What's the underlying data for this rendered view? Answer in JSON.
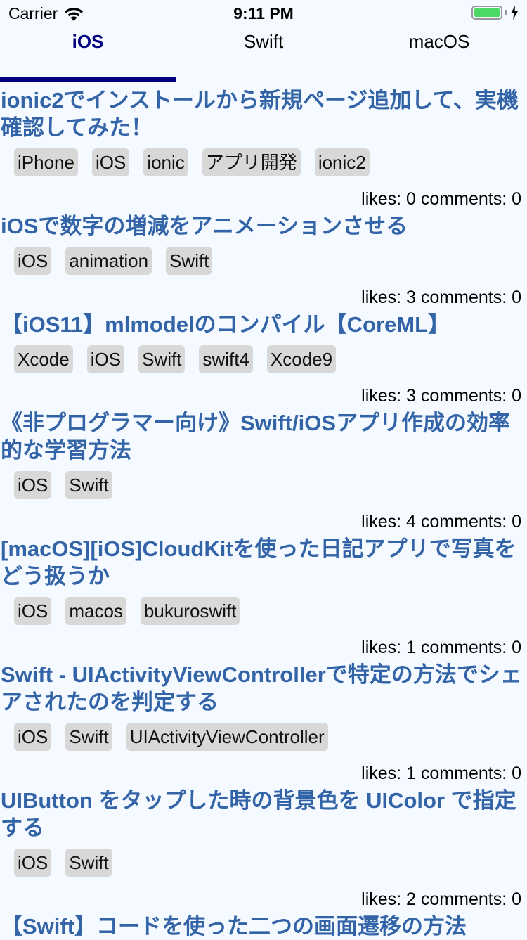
{
  "status_bar": {
    "carrier": "Carrier",
    "time": "9:11 PM",
    "battery_color": "#4cd964"
  },
  "tabs": [
    {
      "label": "iOS",
      "active": true
    },
    {
      "label": "Swift",
      "active": false
    },
    {
      "label": "macOS",
      "active": false
    }
  ],
  "accent_color": "#000080",
  "title_color": "#3464a8",
  "articles": [
    {
      "title": "ionic2でインストールから新規ページ追加して、実機確認してみた！",
      "tags": [
        "iPhone",
        "iOS",
        "ionic",
        "アプリ開発",
        "ionic2"
      ],
      "stats": "likes: 0 comments: 0"
    },
    {
      "title": "iOSで数字の増減をアニメーションさせる",
      "tags": [
        "iOS",
        "animation",
        "Swift"
      ],
      "stats": "likes: 3 comments: 0"
    },
    {
      "title": "【iOS11】mlmodelのコンパイル【CoreML】",
      "tags": [
        "Xcode",
        "iOS",
        "Swift",
        "swift4",
        "Xcode9"
      ],
      "stats": "likes: 3 comments: 0"
    },
    {
      "title": "《非プログラマー向け》Swift/iOSアプリ作成の効率的な学習方法",
      "tags": [
        "iOS",
        "Swift"
      ],
      "stats": "likes: 4 comments: 0"
    },
    {
      "title": "[macOS][iOS]CloudKitを使った日記アプリで写真をどう扱うか",
      "tags": [
        "iOS",
        "macos",
        "bukuroswift"
      ],
      "stats": "likes: 1 comments: 0"
    },
    {
      "title": "Swift - UIActivityViewControllerで特定の方法でシェアされたのを判定する",
      "tags": [
        "iOS",
        "Swift",
        "UIActivityViewController"
      ],
      "stats": "likes: 1 comments: 0"
    },
    {
      "title": "UIButton をタップした時の背景色を UIColor で指定する",
      "tags": [
        "iOS",
        "Swift"
      ],
      "stats": "likes: 2 comments: 0"
    },
    {
      "title": "【Swift】コードを使った二つの画面遷移の方法",
      "tags": [],
      "stats": ""
    }
  ]
}
